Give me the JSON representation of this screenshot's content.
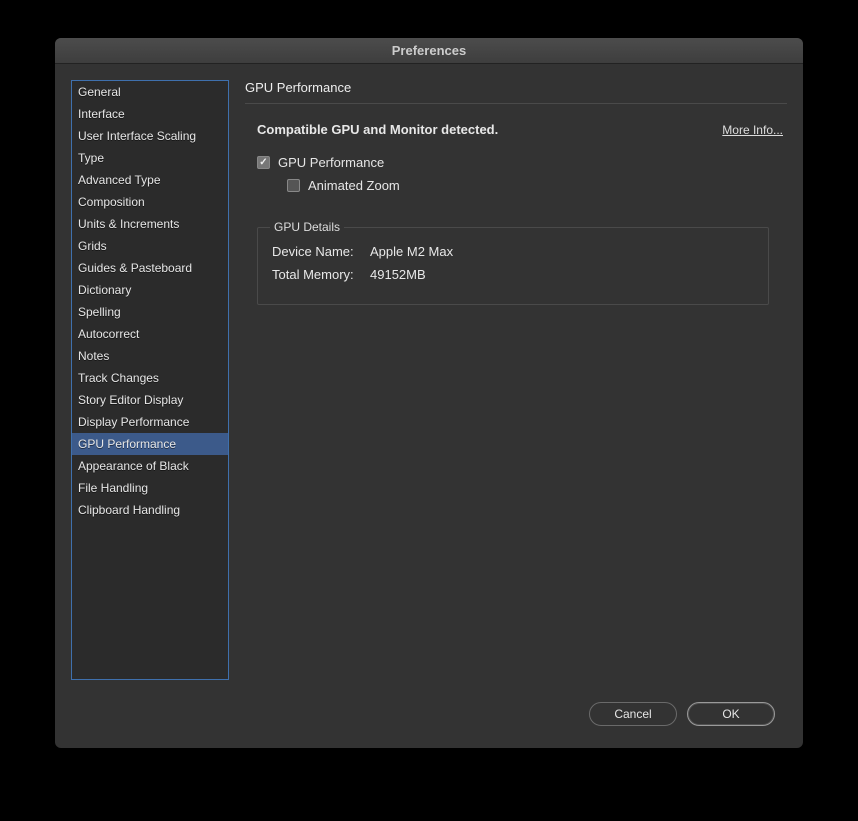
{
  "dialog": {
    "title": "Preferences"
  },
  "sidebar": {
    "items": [
      {
        "label": "General"
      },
      {
        "label": "Interface"
      },
      {
        "label": "User Interface Scaling"
      },
      {
        "label": "Type"
      },
      {
        "label": "Advanced Type"
      },
      {
        "label": "Composition"
      },
      {
        "label": "Units & Increments"
      },
      {
        "label": "Grids"
      },
      {
        "label": "Guides & Pasteboard"
      },
      {
        "label": "Dictionary"
      },
      {
        "label": "Spelling"
      },
      {
        "label": "Autocorrect"
      },
      {
        "label": "Notes"
      },
      {
        "label": "Track Changes"
      },
      {
        "label": "Story Editor Display"
      },
      {
        "label": "Display Performance"
      },
      {
        "label": "GPU Performance"
      },
      {
        "label": "Appearance of Black"
      },
      {
        "label": "File Handling"
      },
      {
        "label": "Clipboard Handling"
      }
    ],
    "selectedIndex": 16
  },
  "main": {
    "panel_title": "GPU Performance",
    "status_text": "Compatible GPU and Monitor detected.",
    "more_info_label": "More Info...",
    "gpu_perf_label": "GPU Performance",
    "gpu_perf_checked": true,
    "animated_zoom_label": "Animated Zoom",
    "animated_zoom_checked": false,
    "details": {
      "legend": "GPU Details",
      "device_label": "Device Name:",
      "device_value": "Apple M2 Max",
      "memory_label": "Total Memory:",
      "memory_value": "49152MB"
    }
  },
  "footer": {
    "cancel_label": "Cancel",
    "ok_label": "OK"
  }
}
